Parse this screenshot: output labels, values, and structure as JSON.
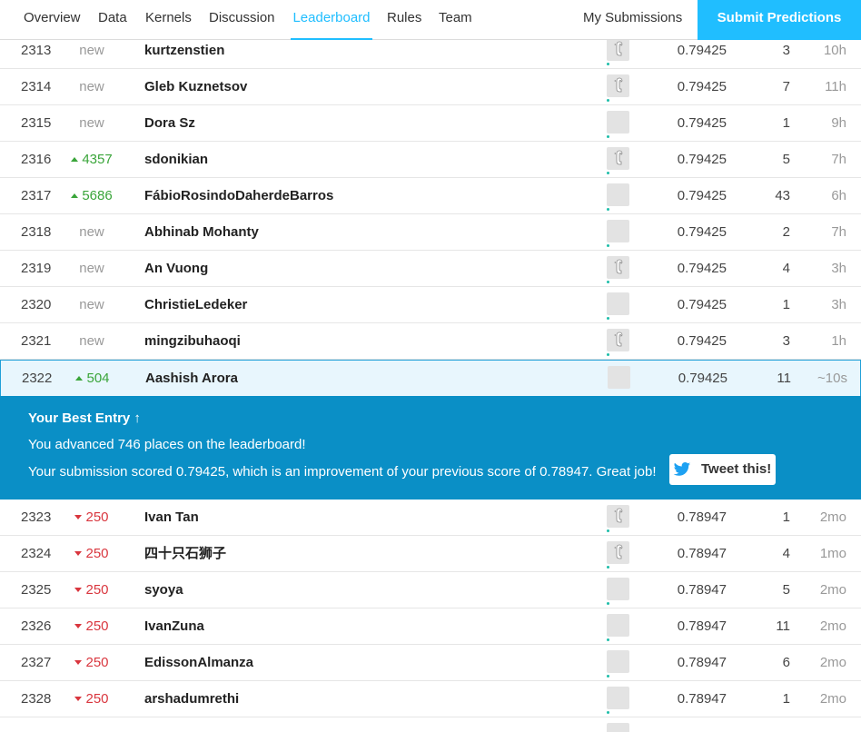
{
  "nav": {
    "tabs": [
      {
        "label": "Overview"
      },
      {
        "label": "Data"
      },
      {
        "label": "Kernels"
      },
      {
        "label": "Discussion"
      },
      {
        "label": "Leaderboard"
      },
      {
        "label": "Rules"
      },
      {
        "label": "Team"
      }
    ],
    "my_submissions": "My Submissions",
    "submit": "Submit Predictions"
  },
  "rows_top": [
    {
      "rank": "2313",
      "delta": "new",
      "name": "kurtzenstien",
      "score": "0.79425",
      "entries": "3",
      "last": "10h"
    },
    {
      "rank": "2314",
      "delta": "new",
      "name": "Gleb Kuznetsov",
      "score": "0.79425",
      "entries": "7",
      "last": "11h"
    },
    {
      "rank": "2315",
      "delta": "new",
      "name": "Dora Sz",
      "score": "0.79425",
      "entries": "1",
      "last": "9h"
    },
    {
      "rank": "2316",
      "delta": "4357",
      "name": "sdonikian",
      "score": "0.79425",
      "entries": "5",
      "last": "7h"
    },
    {
      "rank": "2317",
      "delta": "5686",
      "name": "FábioRosindoDaherdeBarros",
      "score": "0.79425",
      "entries": "43",
      "last": "6h"
    },
    {
      "rank": "2318",
      "delta": "new",
      "name": "Abhinab Mohanty",
      "score": "0.79425",
      "entries": "2",
      "last": "7h"
    },
    {
      "rank": "2319",
      "delta": "new",
      "name": "An Vuong",
      "score": "0.79425",
      "entries": "4",
      "last": "3h"
    },
    {
      "rank": "2320",
      "delta": "new",
      "name": "ChristieLedeker",
      "score": "0.79425",
      "entries": "1",
      "last": "3h"
    },
    {
      "rank": "2321",
      "delta": "new",
      "name": "mingzibuhaoqi",
      "score": "0.79425",
      "entries": "3",
      "last": "1h"
    }
  ],
  "my_row": {
    "rank": "2322",
    "delta": "504",
    "name": "Aashish Arora",
    "score": "0.79425",
    "entries": "11",
    "last": "~10s"
  },
  "banner": {
    "title": "Your Best Entry",
    "arrow": "↑",
    "line1": "You advanced 746 places on the leaderboard!",
    "line2": "Your submission scored 0.79425, which is an improvement of your previous score of 0.78947. Great job!",
    "tweet": "Tweet this!"
  },
  "rows_bottom": [
    {
      "rank": "2323",
      "delta": "250",
      "name": "Ivan Tan",
      "score": "0.78947",
      "entries": "1",
      "last": "2mo"
    },
    {
      "rank": "2324",
      "delta": "250",
      "name": "四十只石狮子",
      "score": "0.78947",
      "entries": "4",
      "last": "1mo"
    },
    {
      "rank": "2325",
      "delta": "250",
      "name": "syoya",
      "score": "0.78947",
      "entries": "5",
      "last": "2mo"
    },
    {
      "rank": "2326",
      "delta": "250",
      "name": "IvanZuna",
      "score": "0.78947",
      "entries": "11",
      "last": "2mo"
    },
    {
      "rank": "2327",
      "delta": "250",
      "name": "EdissonAlmanza",
      "score": "0.78947",
      "entries": "6",
      "last": "2mo"
    },
    {
      "rank": "2328",
      "delta": "250",
      "name": "arshadumrethi",
      "score": "0.78947",
      "entries": "1",
      "last": "2mo"
    }
  ],
  "colors": {
    "accent": "#20beff",
    "banner": "#0a8fc6",
    "up": "#3aa53a",
    "down": "#d9363e"
  }
}
